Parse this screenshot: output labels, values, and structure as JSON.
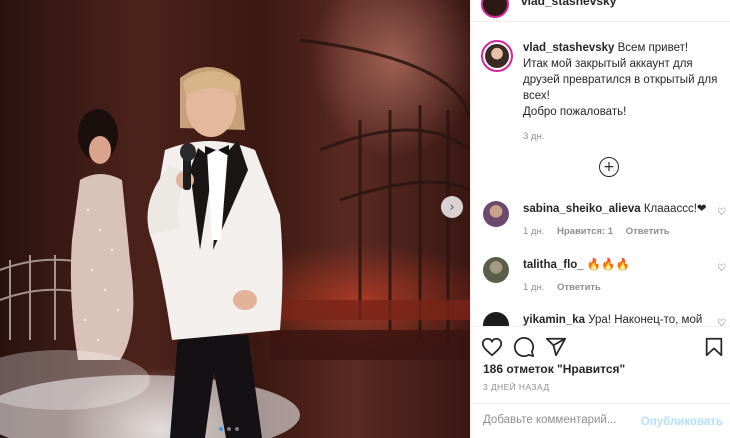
{
  "post": {
    "author": "vlad_stashevsky",
    "header_username": "vlad_stashevsky",
    "caption_lines": [
      "Всем привет!",
      "Итак мой закрытый аккаунт для",
      "друзей превратился в открытый для",
      "всех!",
      "Добро пожаловать!"
    ],
    "caption_time": "3 дн.",
    "likes": "186 отметок \"Нравится\"",
    "date": "3 ДНЕЙ НАЗАД"
  },
  "carousel": {
    "next_icon": "chevron-right-icon",
    "slides": 3,
    "active_slide": 1
  },
  "comments": [
    {
      "user": "sabina_sheiko_alieva",
      "text": "Клааассс!❤",
      "time": "1 дн.",
      "likes_label": "Нравится: 1",
      "reply": "Ответить",
      "avatar_color": "#6b4a6e"
    },
    {
      "user": "talitha_flo_",
      "text": "🔥🔥🔥",
      "time": "1 дн.",
      "reply": "Ответить",
      "avatar_color": "#5a5f48"
    },
    {
      "user": "yikamin_ka",
      "text": "Ура! Наконец-то, мой",
      "avatar_color": "#1c1c1c"
    }
  ],
  "actions": {
    "like": "heart-icon",
    "comment": "comment-icon",
    "share": "send-icon",
    "save": "bookmark-icon"
  },
  "add_comment": {
    "placeholder": "Добавьте комментарий...",
    "publish": "Опубликовать"
  },
  "colors": {
    "accent": "#3797f0",
    "publish_disabled": "#b2dffc",
    "muted": "#8e8e8e",
    "story_ring": "#d6249f"
  }
}
